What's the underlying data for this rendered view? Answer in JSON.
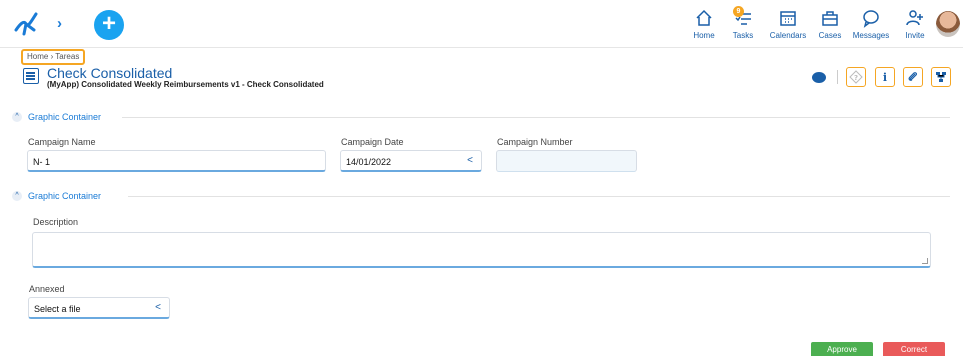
{
  "topbar": {
    "nav": [
      {
        "label": "Home",
        "icon": "home-icon"
      },
      {
        "label": "Tasks",
        "icon": "tasks-icon",
        "badge": "9"
      },
      {
        "label": "Calendars",
        "icon": "calendar-icon"
      },
      {
        "label": "Cases",
        "icon": "briefcase-icon"
      },
      {
        "label": "Messages",
        "icon": "message-icon"
      },
      {
        "label": "Invite",
        "icon": "invite-user-icon"
      }
    ]
  },
  "breadcrumb": "Home › Tareas",
  "page": {
    "title": "Check Consolidated",
    "subtitle": "(MyApp) Consolidated Weekly Reimbursements v1 - Check Consolidated"
  },
  "groups": [
    {
      "title": "Graphic Container",
      "fields": [
        {
          "label": "Campaign Name",
          "value": "N- 1"
        },
        {
          "label": "Campaign Date",
          "value": "14/01/2022"
        },
        {
          "label": "Campaign Number",
          "value": ""
        }
      ]
    },
    {
      "title": "Graphic Container",
      "description_label": "Description",
      "description_value": ""
    }
  ],
  "annexed": {
    "label": "Annexed",
    "value": "Select a file"
  },
  "actions": {
    "approve": "Approve",
    "correct": "Correct"
  },
  "colors": {
    "accent": "#1a5fa8",
    "highlight": "#f5a623",
    "approve": "#4caf50",
    "correct": "#e95a5a"
  }
}
